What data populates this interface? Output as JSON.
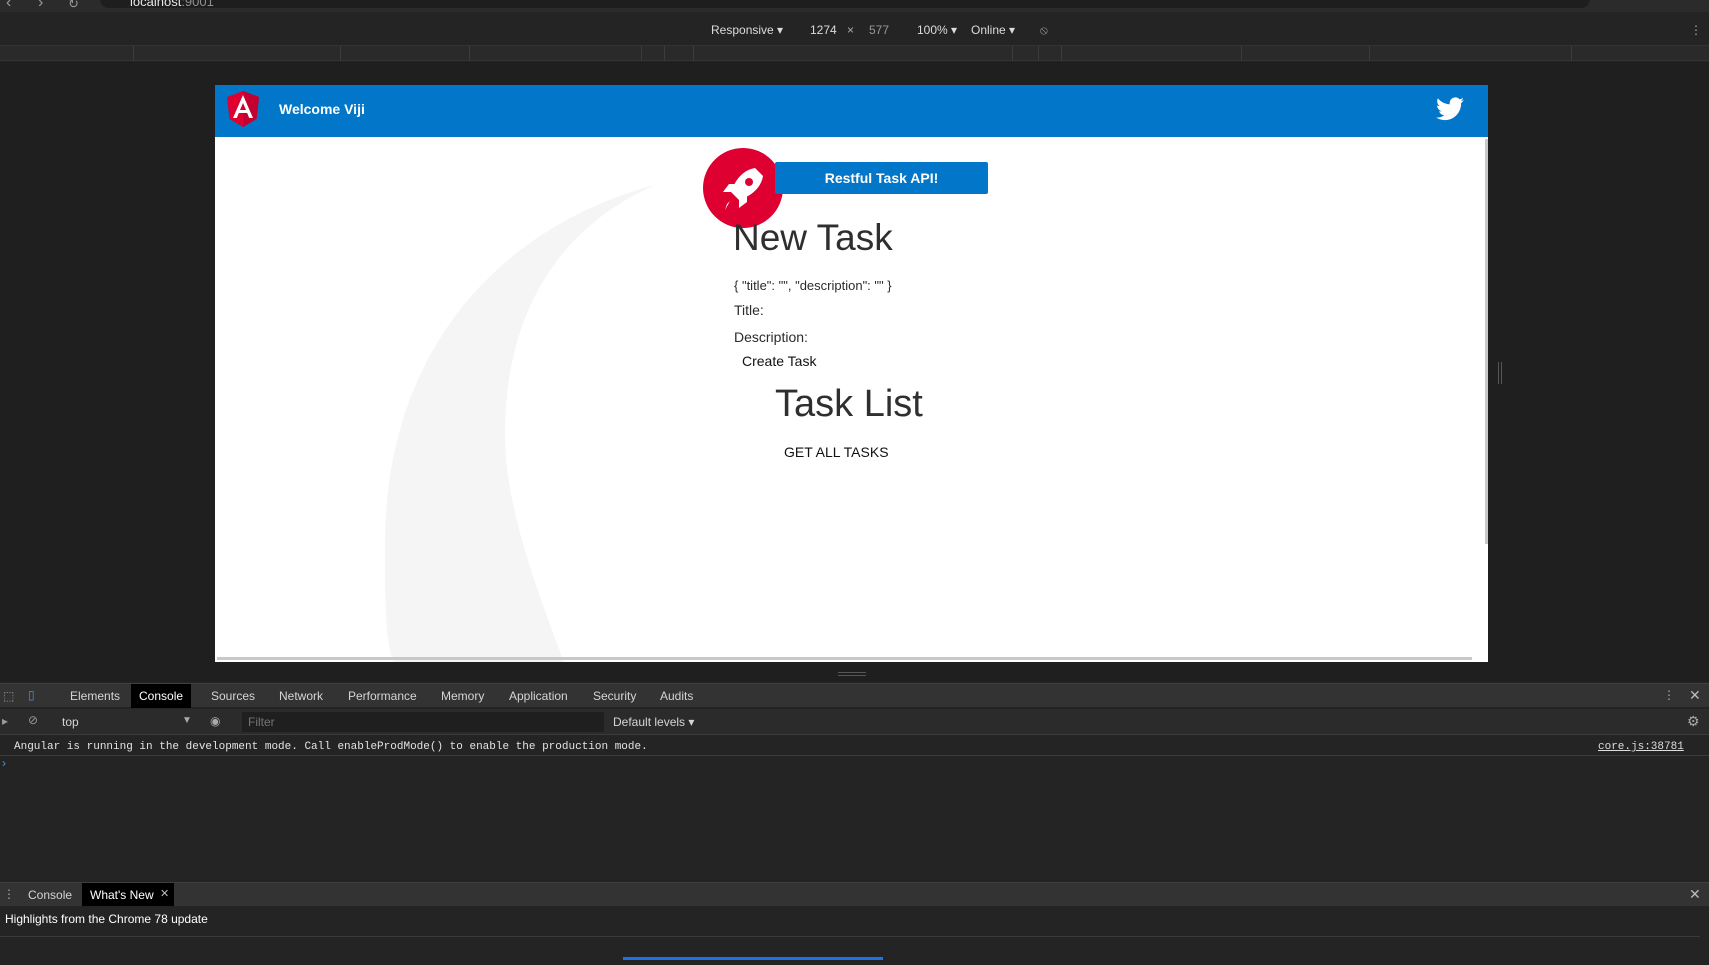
{
  "browser": {
    "url_host": "localhost",
    "url_port": ":9001"
  },
  "device_toolbar": {
    "mode": "Responsive",
    "width": "1274",
    "height": "577",
    "zoom": "100%",
    "network": "Online"
  },
  "app": {
    "header_title": "Welcome Viji",
    "api_button": "Restful Task API!",
    "new_task_heading": "New Task",
    "json_preview": "{ \"title\": \"\", \"description\": \"\" }",
    "title_label": "Title:",
    "description_label": "Description:",
    "create_button": "Create Task",
    "task_list_heading": "Task List",
    "get_all_button": "GET ALL TASKS"
  },
  "devtools": {
    "tabs": [
      "Elements",
      "Console",
      "Sources",
      "Network",
      "Performance",
      "Memory",
      "Application",
      "Security",
      "Audits"
    ],
    "active_tab": "Console",
    "context": "top",
    "filter_placeholder": "Filter",
    "levels": "Default levels",
    "console_message": "Angular is running in the development mode. Call enableProdMode() to enable the production mode.",
    "console_source": "core.js:38781",
    "drawer_tabs": [
      "Console",
      "What's New"
    ],
    "drawer_active": "What's New",
    "drawer_text": "Highlights from the Chrome 78 update"
  },
  "colors": {
    "header_blue": "#0276c8",
    "angular_red": "#dd0031"
  }
}
